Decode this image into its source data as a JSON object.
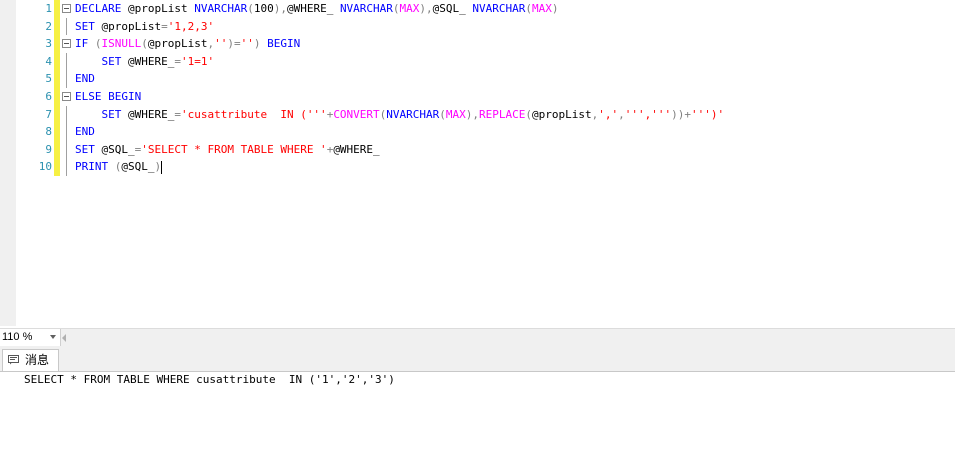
{
  "editor": {
    "lines": [
      {
        "n": "1",
        "tokens": [
          {
            "c": "kw",
            "t": "DECLARE "
          },
          {
            "c": "tx",
            "t": "@propList "
          },
          {
            "c": "kw",
            "t": "NVARCHAR"
          },
          {
            "c": "op",
            "t": "("
          },
          {
            "c": "tx",
            "t": "100"
          },
          {
            "c": "op",
            "t": "),"
          },
          {
            "c": "tx",
            "t": "@WHERE_ "
          },
          {
            "c": "kw",
            "t": "NVARCHAR"
          },
          {
            "c": "op",
            "t": "("
          },
          {
            "c": "fn",
            "t": "MAX"
          },
          {
            "c": "op",
            "t": "),"
          },
          {
            "c": "tx",
            "t": "@SQL_ "
          },
          {
            "c": "kw",
            "t": "NVARCHAR"
          },
          {
            "c": "op",
            "t": "("
          },
          {
            "c": "fn",
            "t": "MAX"
          },
          {
            "c": "op",
            "t": ")"
          }
        ]
      },
      {
        "n": "2",
        "tokens": [
          {
            "c": "kw",
            "t": "SET "
          },
          {
            "c": "tx",
            "t": "@propList"
          },
          {
            "c": "op",
            "t": "="
          },
          {
            "c": "st",
            "t": "'1,2,3'"
          }
        ]
      },
      {
        "n": "3",
        "tokens": [
          {
            "c": "kw",
            "t": "IF "
          },
          {
            "c": "op",
            "t": "("
          },
          {
            "c": "fn",
            "t": "ISNULL"
          },
          {
            "c": "op",
            "t": "("
          },
          {
            "c": "tx",
            "t": "@propList"
          },
          {
            "c": "op",
            "t": ","
          },
          {
            "c": "st",
            "t": "''"
          },
          {
            "c": "op",
            "t": ")="
          },
          {
            "c": "st",
            "t": "''"
          },
          {
            "c": "op",
            "t": ") "
          },
          {
            "c": "kw",
            "t": "BEGIN"
          }
        ]
      },
      {
        "n": "4",
        "tokens": [
          {
            "c": "tx",
            "t": "    "
          },
          {
            "c": "kw",
            "t": "SET "
          },
          {
            "c": "tx",
            "t": "@WHERE_"
          },
          {
            "c": "op",
            "t": "="
          },
          {
            "c": "st",
            "t": "'1=1'"
          }
        ]
      },
      {
        "n": "5",
        "tokens": [
          {
            "c": "kw",
            "t": "END"
          }
        ]
      },
      {
        "n": "6",
        "tokens": [
          {
            "c": "kw",
            "t": "ELSE BEGIN"
          }
        ]
      },
      {
        "n": "7",
        "tokens": [
          {
            "c": "tx",
            "t": "    "
          },
          {
            "c": "kw",
            "t": "SET "
          },
          {
            "c": "tx",
            "t": "@WHERE_"
          },
          {
            "c": "op",
            "t": "="
          },
          {
            "c": "st",
            "t": "'cusattribute  IN ('''"
          },
          {
            "c": "op",
            "t": "+"
          },
          {
            "c": "fn",
            "t": "CONVERT"
          },
          {
            "c": "op",
            "t": "("
          },
          {
            "c": "kw",
            "t": "NVARCHAR"
          },
          {
            "c": "op",
            "t": "("
          },
          {
            "c": "fn",
            "t": "MAX"
          },
          {
            "c": "op",
            "t": "),"
          },
          {
            "c": "fn",
            "t": "REPLACE"
          },
          {
            "c": "op",
            "t": "("
          },
          {
            "c": "tx",
            "t": "@propList"
          },
          {
            "c": "op",
            "t": ","
          },
          {
            "c": "st",
            "t": "','"
          },
          {
            "c": "op",
            "t": ","
          },
          {
            "c": "st",
            "t": "''','''"
          },
          {
            "c": "op",
            "t": "))+"
          },
          {
            "c": "st",
            "t": "''')'"
          }
        ]
      },
      {
        "n": "8",
        "tokens": [
          {
            "c": "kw",
            "t": "END"
          }
        ]
      },
      {
        "n": "9",
        "tokens": [
          {
            "c": "kw",
            "t": "SET "
          },
          {
            "c": "tx",
            "t": "@SQL_"
          },
          {
            "c": "op",
            "t": "="
          },
          {
            "c": "st",
            "t": "'SELECT * FROM TABLE WHERE '"
          },
          {
            "c": "op",
            "t": "+"
          },
          {
            "c": "tx",
            "t": "@WHERE_"
          }
        ]
      },
      {
        "n": "10",
        "tokens": [
          {
            "c": "kw",
            "t": "PRINT "
          },
          {
            "c": "op",
            "t": "("
          },
          {
            "c": "tx",
            "t": "@SQL_"
          },
          {
            "c": "op",
            "t": ")"
          }
        ]
      }
    ]
  },
  "statusbar": {
    "zoom": "110 %"
  },
  "results": {
    "tab_label": "消息",
    "output": "SELECT * FROM TABLE WHERE cusattribute  IN ('1','2','3')"
  }
}
